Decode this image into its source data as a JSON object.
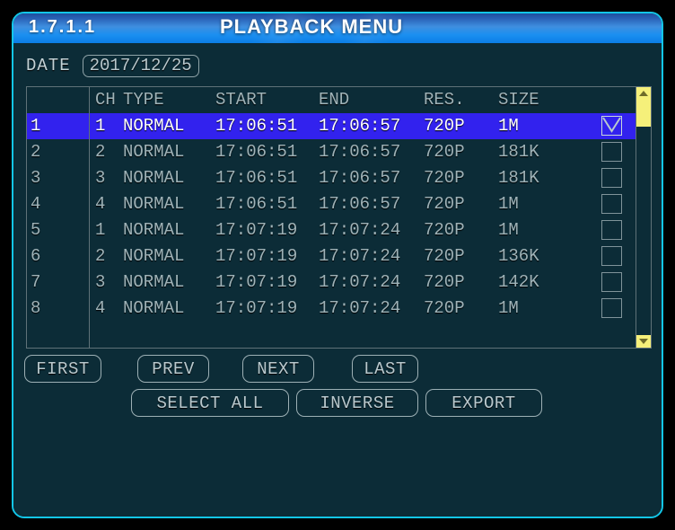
{
  "window": {
    "menu_code": "1.7.1.1",
    "title": "PLAYBACK MENU",
    "accent_border": "#13c6e8",
    "background": "#0c2c37",
    "title_gradient_from": "#1e4f9e",
    "title_gradient_to": "#0b7ee6",
    "selection_color": "#3222ee",
    "scrollbar_color": "#f5f07a"
  },
  "date_field": {
    "label": "DATE",
    "value": "2017/12/25",
    "placeholder": "YYYY/MM/DD"
  },
  "table": {
    "headers": {
      "index": "",
      "ch": "CH",
      "type": "TYPE",
      "start": "START",
      "end": "END",
      "res": "RES.",
      "size": "SIZE"
    },
    "rows": [
      {
        "index": "1",
        "ch": "1",
        "type": "NORMAL",
        "start": "17:06:51",
        "end": "17:06:57",
        "res": "720P",
        "size": "1M",
        "checked": true,
        "selected": true
      },
      {
        "index": "2",
        "ch": "2",
        "type": "NORMAL",
        "start": "17:06:51",
        "end": "17:06:57",
        "res": "720P",
        "size": "181K",
        "checked": false,
        "selected": false
      },
      {
        "index": "3",
        "ch": "3",
        "type": "NORMAL",
        "start": "17:06:51",
        "end": "17:06:57",
        "res": "720P",
        "size": "181K",
        "checked": false,
        "selected": false
      },
      {
        "index": "4",
        "ch": "4",
        "type": "NORMAL",
        "start": "17:06:51",
        "end": "17:06:57",
        "res": "720P",
        "size": "1M",
        "checked": false,
        "selected": false
      },
      {
        "index": "5",
        "ch": "1",
        "type": "NORMAL",
        "start": "17:07:19",
        "end": "17:07:24",
        "res": "720P",
        "size": "1M",
        "checked": false,
        "selected": false
      },
      {
        "index": "6",
        "ch": "2",
        "type": "NORMAL",
        "start": "17:07:19",
        "end": "17:07:24",
        "res": "720P",
        "size": "136K",
        "checked": false,
        "selected": false
      },
      {
        "index": "7",
        "ch": "3",
        "type": "NORMAL",
        "start": "17:07:19",
        "end": "17:07:24",
        "res": "720P",
        "size": "142K",
        "checked": false,
        "selected": false
      },
      {
        "index": "8",
        "ch": "4",
        "type": "NORMAL",
        "start": "17:07:19",
        "end": "17:07:24",
        "res": "720P",
        "size": "1M",
        "checked": false,
        "selected": false
      }
    ]
  },
  "scrollbar": {
    "up_icon": "triangle-up-icon",
    "down_icon": "triangle-down-icon"
  },
  "buttons": {
    "first": "FIRST",
    "prev": "PREV",
    "next": "NEXT",
    "last": "LAST",
    "select_all": "SELECT ALL",
    "inverse": "INVERSE",
    "export": "EXPORT"
  }
}
